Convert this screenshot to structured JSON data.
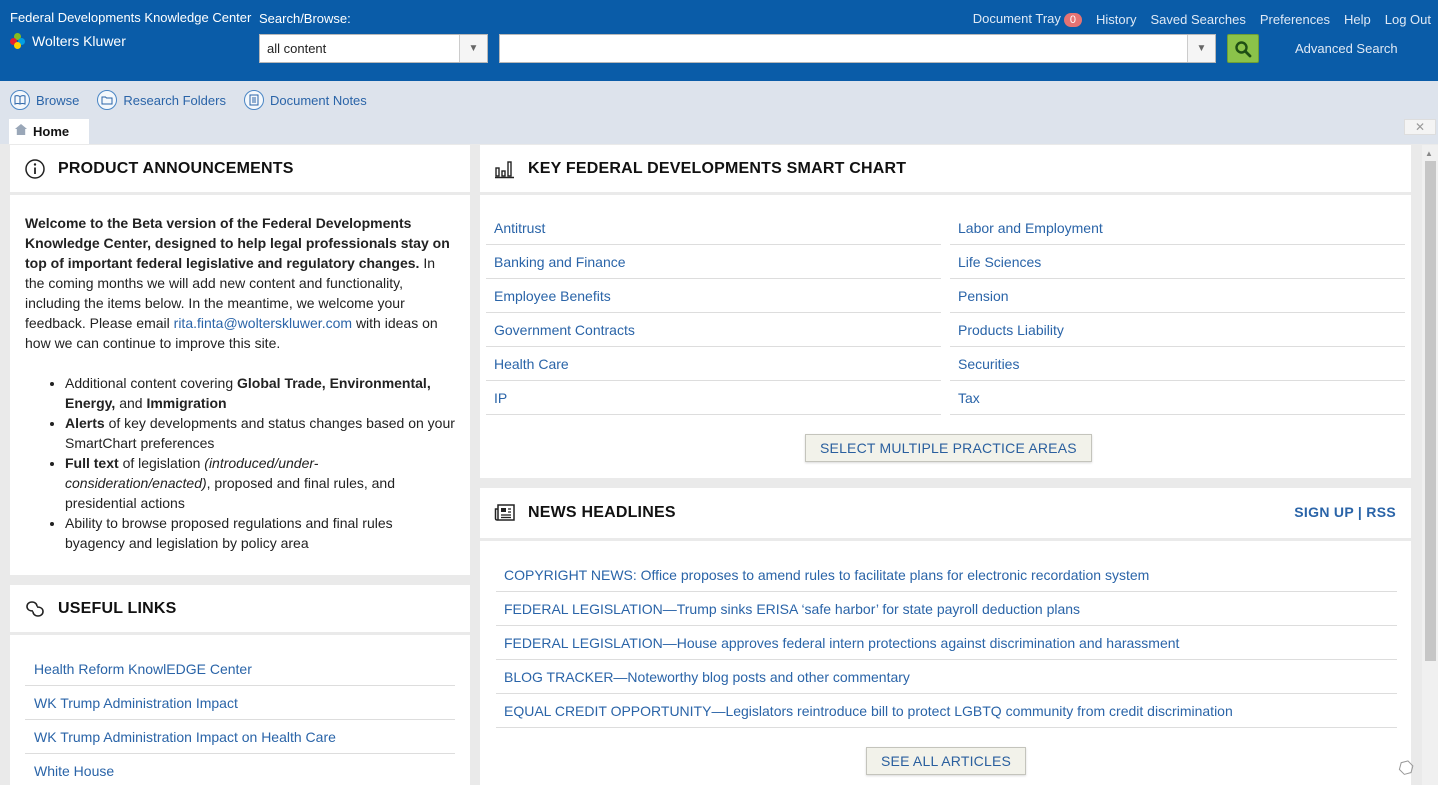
{
  "header": {
    "app_title": "Federal Developments Knowledge Center",
    "brand": "Wolters Kluwer",
    "search_label": "Search/Browse:",
    "scope_value": "all content",
    "search_value": "",
    "advanced_search": "Advanced Search",
    "nav": {
      "document_tray": "Document Tray",
      "tray_count": "0",
      "history": "History",
      "saved_searches": "Saved Searches",
      "preferences": "Preferences",
      "help": "Help",
      "logout": "Log Out"
    },
    "colors": {
      "bar": "#0a5ca8",
      "go_button": "#8bc34a"
    }
  },
  "toolbar": {
    "browse": "Browse",
    "research_folders": "Research Folders",
    "document_notes": "Document Notes"
  },
  "tabs": {
    "home": "Home"
  },
  "announcements": {
    "title": "PRODUCT ANNOUNCEMENTS",
    "intro_bold": "Welcome to the Beta version of the Federal Developments Knowledge Center, designed to help legal professionals stay on top of important federal legislative and regulatory changes.",
    "intro_rest": "In the coming months we will add new content and functionality, including the items below.  In the meantime, we welcome your feedback.  Please email",
    "email": "rita.finta@wolterskluwer.com",
    "intro_end": "with ideas on how we can continue to improve this site.",
    "b1_pre": "Additional content covering",
    "b1_bold1": "Global Trade, Environmental, Energy,",
    "b1_and": "and",
    "b1_bold2": "Immigration",
    "b2_bold": "Alerts",
    "b2_rest": "of key developments and status changes based on your SmartChart preferences",
    "b3_bold": "Full text",
    "b3_mid": "of legislation",
    "b3_italic": "(introduced/under-consideration/enacted)",
    "b3_rest": ", proposed and final rules, and presidential actions",
    "b4": "Ability to browse proposed regulations and final rules byagency and legislation by policy area"
  },
  "useful_links": {
    "title": "USEFUL LINKS",
    "items": [
      "Health Reform KnowlEDGE Center",
      "WK Trump Administration Impact",
      "WK Trump Administration Impact on Health Care",
      "White House"
    ]
  },
  "smart_chart": {
    "title": "KEY FEDERAL DEVELOPMENTS SMART CHART",
    "left": [
      "Antitrust",
      "Banking and Finance",
      "Employee Benefits",
      "Government Contracts",
      "Health Care",
      "IP"
    ],
    "right": [
      "Labor and Employment",
      "Life Sciences",
      "Pension",
      "Products Liability",
      "Securities",
      "Tax"
    ],
    "button": "SELECT MULTIPLE PRACTICE AREAS"
  },
  "news": {
    "title": "NEWS HEADLINES",
    "signup": "SIGN UP | RSS",
    "items": [
      "COPYRIGHT NEWS: Office proposes to amend rules to facilitate plans for electronic recordation system",
      "FEDERAL LEGISLATION—Trump sinks ERISA ‘safe harbor’ for state payroll deduction plans",
      "FEDERAL LEGISLATION—House approves federal intern protections against discrimination and harassment",
      "BLOG TRACKER—Noteworthy blog posts and other commentary",
      "EQUAL CREDIT OPPORTUNITY—Legislators reintroduce bill to protect LGBTQ community from credit discrimination"
    ],
    "button": "SEE ALL ARTICLES"
  },
  "icons": [
    "info-icon",
    "bar-chart-icon",
    "newspaper-icon",
    "link-icon",
    "search-icon",
    "book-icon",
    "folder-icon",
    "notes-icon",
    "home-icon"
  ]
}
